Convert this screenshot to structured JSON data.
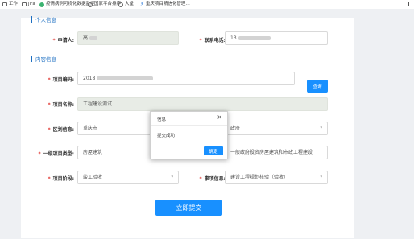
{
  "bookmarks": [
    {
      "label": "工作",
      "icon": "folder-icon"
    },
    {
      "label": "jira",
      "icon": "folder-icon"
    },
    {
      "label": "疫情病例可视化数据监控",
      "icon": "green-circle-icon"
    },
    {
      "label": "国家平台排序",
      "icon": "globe-icon"
    },
    {
      "label": "大堂",
      "icon": "globe-icon"
    },
    {
      "label": "重庆项目精信化管理…",
      "icon": "lightning-icon"
    }
  ],
  "sections": {
    "personal": "个人信息",
    "content": "内容信息"
  },
  "form": {
    "applicant": {
      "label": "申请人:",
      "value": "高"
    },
    "phone": {
      "label": "联系电话:",
      "value": "13"
    },
    "project_code": {
      "label": "项目编码:",
      "value": "2018"
    },
    "query_button": "查询",
    "project_name": {
      "label": "项目名称:",
      "value": "工程建设测试"
    },
    "region": {
      "label": "区划信息:",
      "value": "重庆市",
      "value2": "政府"
    },
    "project_type": {
      "label": "一级项目类型:",
      "value": "房屋建筑",
      "value2": "一般政府投资房屋建筑和市政工程建设"
    },
    "stage": {
      "label": "项目阶段:",
      "value": "竣工验收"
    },
    "matter": {
      "label": "事项信息:",
      "value": "建设工程规划核验（验收）"
    },
    "submit_button": "立即提交"
  },
  "modal": {
    "title": "信息",
    "message": "提交成功",
    "ok_button": "确定"
  },
  "colors": {
    "accent": "#1890ff",
    "required": "#e0302b",
    "section": "#1d6fc2"
  }
}
